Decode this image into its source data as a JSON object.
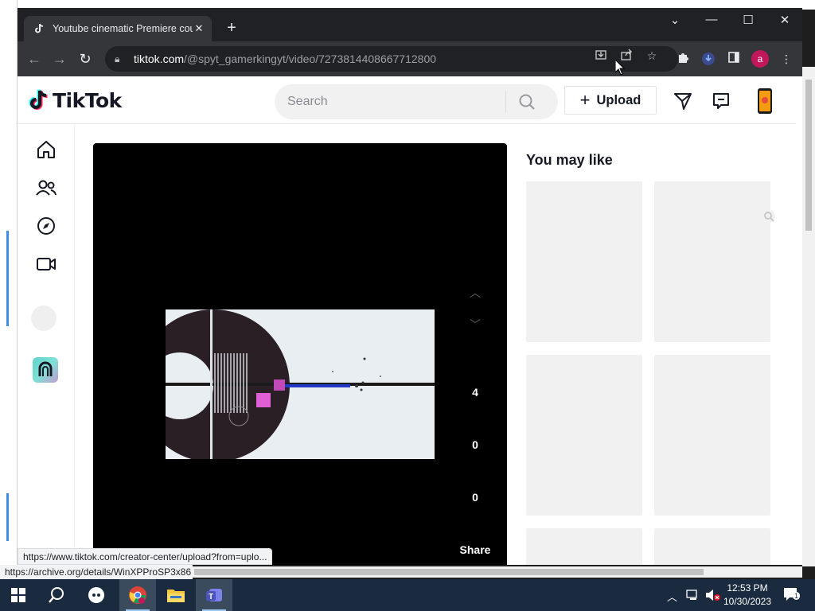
{
  "browser": {
    "tab_title": "Youtube cinematic Premiere cou",
    "new_tab_symbol": "+",
    "url_host": "tiktok.com",
    "url_path": "/@spyt_gamerkingyt/video/7273814408667712800",
    "profile_initial": "a"
  },
  "tiktok": {
    "logo_text": "TikTok",
    "search_placeholder": "Search",
    "upload_label": "Upload",
    "upload_plus": "+",
    "you_may_like": "You may like",
    "counts": {
      "likes": "4",
      "comments": "0",
      "saves": "0"
    },
    "share_label": "Share"
  },
  "status": {
    "page_hover_url": "https://www.tiktok.com/creator-center/upload?from=uplo...",
    "outer_status_url": "https://archive.org/details/WinXPProSP3x86"
  },
  "taskbar": {
    "time": "12:53 PM",
    "date": "10/30/2023",
    "notification_count": "1"
  },
  "colors": {
    "tiktok_pink": "#fe2c55",
    "tiktok_cyan": "#25f4ee",
    "chrome_dark": "#35363a",
    "taskbar": "#1b2b3f"
  }
}
